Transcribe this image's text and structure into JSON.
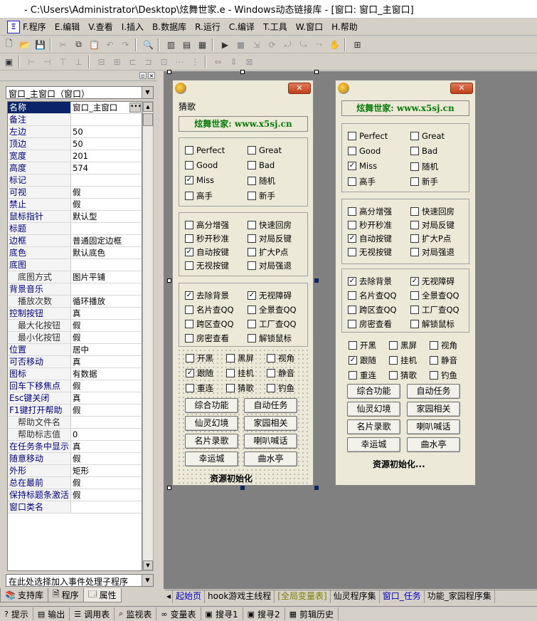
{
  "title": "- C:\\Users\\Administrator\\Desktop\\炫舞世家.e - Windows动态链接库 - [窗口: 窗口_主窗口]",
  "menu": [
    "F.程序",
    "E.编辑",
    "V.查看",
    "I.插入",
    "B.数据库",
    "R.运行",
    "C.编译",
    "T.工具",
    "W.窗口",
    "H.帮助"
  ],
  "object_selector": "窗口_主窗口（窗口）",
  "properties": [
    {
      "k": "名称",
      "v": "窗口_主窗口",
      "sub": false
    },
    {
      "k": "备注",
      "v": "",
      "sub": false
    },
    {
      "k": "左边",
      "v": "50",
      "sub": false
    },
    {
      "k": "顶边",
      "v": "50",
      "sub": false
    },
    {
      "k": "宽度",
      "v": "201",
      "sub": false
    },
    {
      "k": "高度",
      "v": "574",
      "sub": false
    },
    {
      "k": "标记",
      "v": "",
      "sub": false
    },
    {
      "k": "可视",
      "v": "假",
      "sub": false
    },
    {
      "k": "禁止",
      "v": "假",
      "sub": false
    },
    {
      "k": "鼠标指针",
      "v": "默认型",
      "sub": false
    },
    {
      "k": "标题",
      "v": "",
      "sub": false
    },
    {
      "k": "边框",
      "v": "普通固定边框",
      "sub": false
    },
    {
      "k": "底色",
      "v": "默认底色",
      "sub": false
    },
    {
      "k": "底图",
      "v": "",
      "sub": false
    },
    {
      "k": "底图方式",
      "v": "图片平铺",
      "sub": true
    },
    {
      "k": "背景音乐",
      "v": "",
      "sub": false
    },
    {
      "k": "播放次数",
      "v": "循环播放",
      "sub": true
    },
    {
      "k": "控制按钮",
      "v": "真",
      "sub": false
    },
    {
      "k": "最大化按钮",
      "v": "假",
      "sub": true
    },
    {
      "k": "最小化按钮",
      "v": "假",
      "sub": true
    },
    {
      "k": "位置",
      "v": "居中",
      "sub": false
    },
    {
      "k": "可否移动",
      "v": "真",
      "sub": false
    },
    {
      "k": "图标",
      "v": "有数据",
      "sub": false
    },
    {
      "k": "回车下移焦点",
      "v": "假",
      "sub": false
    },
    {
      "k": "Esc键关闭",
      "v": "真",
      "sub": false
    },
    {
      "k": "F1键打开帮助",
      "v": "假",
      "sub": false
    },
    {
      "k": "帮助文件名",
      "v": "",
      "sub": true
    },
    {
      "k": "帮助标志值",
      "v": "0",
      "sub": true
    },
    {
      "k": "在任务条中显示",
      "v": "真",
      "sub": false
    },
    {
      "k": "随意移动",
      "v": "假",
      "sub": false
    },
    {
      "k": "外形",
      "v": "矩形",
      "sub": false
    },
    {
      "k": "总在最前",
      "v": "假",
      "sub": false
    },
    {
      "k": "保持标题条激活",
      "v": "假",
      "sub": false
    },
    {
      "k": "窗口类名",
      "v": "",
      "sub": false
    }
  ],
  "event_selector": "在此处选择加入事件处理子程序",
  "left_tabs": [
    "支持库",
    "程序",
    "属性"
  ],
  "designer": {
    "window_label": "猜歌",
    "banner": "炫舞世家: www.x5sj.cn",
    "status": "资源初始化",
    "preview_status": "资源初始化...",
    "group1": [
      {
        "label": "Perfect",
        "checked": false
      },
      {
        "label": "Great",
        "checked": false
      },
      {
        "label": "Good",
        "checked": false
      },
      {
        "label": "Bad",
        "checked": false
      },
      {
        "label": "Miss",
        "checked": true
      },
      {
        "label": "随机",
        "checked": false
      },
      {
        "label": "高手",
        "checked": false
      },
      {
        "label": "新手",
        "checked": false
      }
    ],
    "group2": [
      {
        "label": "高分增强",
        "checked": false
      },
      {
        "label": "快速回房",
        "checked": false
      },
      {
        "label": "秒开秒准",
        "checked": false
      },
      {
        "label": "对局反键",
        "checked": false
      },
      {
        "label": "自动按键",
        "checked": true
      },
      {
        "label": "扩大P点",
        "checked": false
      },
      {
        "label": "无视按键",
        "checked": false
      },
      {
        "label": "对局强退",
        "checked": false
      }
    ],
    "group3": [
      {
        "label": "去除背景",
        "checked": true
      },
      {
        "label": "无视障碍",
        "checked": true
      },
      {
        "label": "名片查QQ",
        "checked": false
      },
      {
        "label": "全景查QQ",
        "checked": false
      },
      {
        "label": "跨区查QQ",
        "checked": false
      },
      {
        "label": "工厂查QQ",
        "checked": false
      },
      {
        "label": "房密查看",
        "checked": false
      },
      {
        "label": "解锁鼠标",
        "checked": false
      }
    ],
    "group4": [
      {
        "label": "开黑",
        "checked": false
      },
      {
        "label": "黑屏",
        "checked": false
      },
      {
        "label": "视角",
        "checked": false
      },
      {
        "label": "跟随",
        "checked": true
      },
      {
        "label": "挂机",
        "checked": false
      },
      {
        "label": "静音",
        "checked": false
      },
      {
        "label": "重连",
        "checked": false
      },
      {
        "label": "猜歌",
        "checked": false
      },
      {
        "label": "钓鱼",
        "checked": false
      }
    ],
    "buttons": [
      "综合功能",
      "自动任务",
      "仙灵幻境",
      "家园相关",
      "名片录歌",
      "喇叭喊话",
      "幸运城",
      "曲水亭"
    ]
  },
  "bottom_tabs": [
    "起始页",
    "hook游戏主线程",
    "[全局变量表]",
    "仙灵程序集",
    "窗口_任务",
    "功能_家园程序集"
  ],
  "status_tabs": [
    "提示",
    "输出",
    "调用表",
    "监视表",
    "变量表",
    "搜寻1",
    "搜寻2",
    "剪辑历史"
  ]
}
